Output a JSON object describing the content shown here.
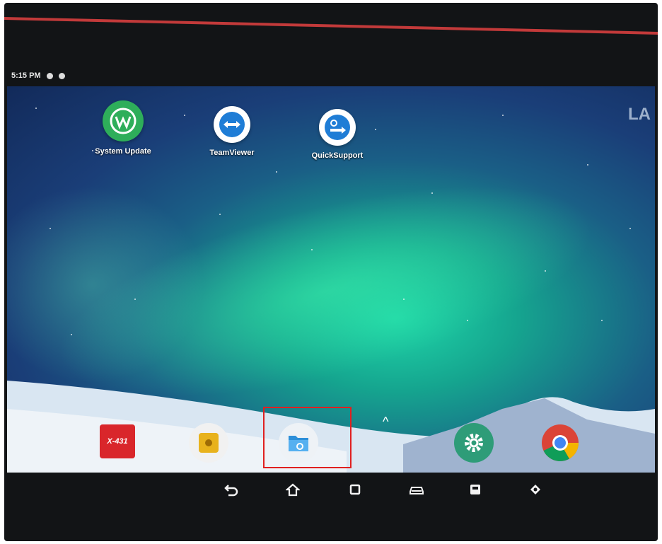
{
  "status_bar": {
    "time": "5:15 PM"
  },
  "home_apps": [
    {
      "label": "System Update"
    },
    {
      "label": "TeamViewer"
    },
    {
      "label": "QuickSupport"
    }
  ],
  "lock_edge_text": "LA",
  "dock": {
    "x431_text": "X-431",
    "items": [
      "x431-icon",
      "camera-icon",
      "file-manager-icon",
      "settings-icon",
      "chrome-icon"
    ]
  },
  "colors": {
    "highlight": "#e02020",
    "system_update": "#2eae5a",
    "teamviewer": "#1f7dd6",
    "x431": "#d9262b"
  }
}
